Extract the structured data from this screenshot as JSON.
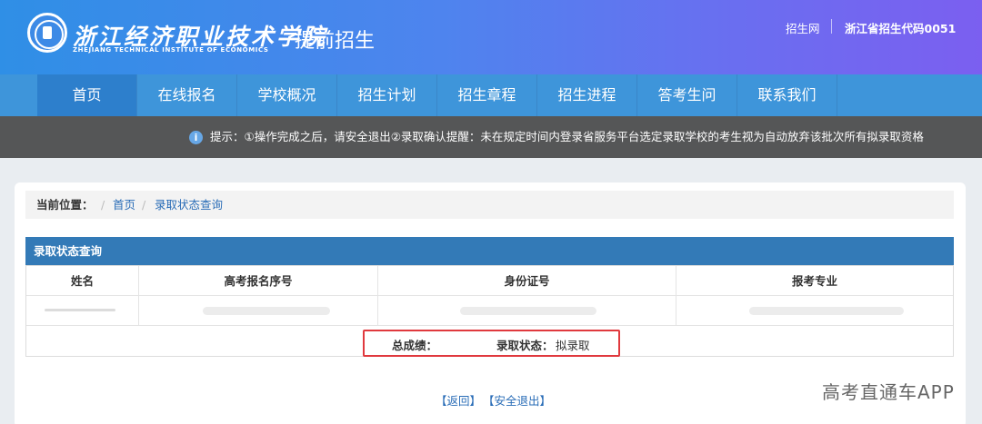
{
  "header": {
    "school_name": "浙江经济职业技术学院",
    "subtitle": "提前招生",
    "school_name_en": "ZHEJIANG TECHNICAL INSTITUTE OF ECONOMICS",
    "links": [
      "招生网",
      "浙江省招生代码0051"
    ]
  },
  "nav": {
    "items": [
      "首页",
      "在线报名",
      "学校概况",
      "招生计划",
      "招生章程",
      "招生进程",
      "答考生问",
      "联系我们"
    ],
    "active_index": 0
  },
  "notice": {
    "icon": "i",
    "text": "提示：①操作完成之后，请安全退出②录取确认提醒：未在规定时间内登录省服务平台选定录取学校的考生视为自动放弃该批次所有拟录取资格"
  },
  "breadcrumb": {
    "label": "当前位置：",
    "sep": "/",
    "items": [
      "首页",
      "录取状态查询"
    ]
  },
  "panel": {
    "title": "录取状态查询",
    "columns": [
      "姓名",
      "高考报名序号",
      "身份证号",
      "报考专业"
    ],
    "result": {
      "score_label": "总成绩：",
      "score_value": "",
      "status_label": "录取状态：",
      "status_value": "拟录取"
    }
  },
  "footer": {
    "back": "【返回】",
    "logout": "【安全退出】"
  },
  "watermark": "高考直通车APP",
  "colors": {
    "nav_bg": "#3e95da",
    "panel_head": "#337ab7",
    "highlight_border": "#e0393e",
    "link": "#2a6db7"
  }
}
